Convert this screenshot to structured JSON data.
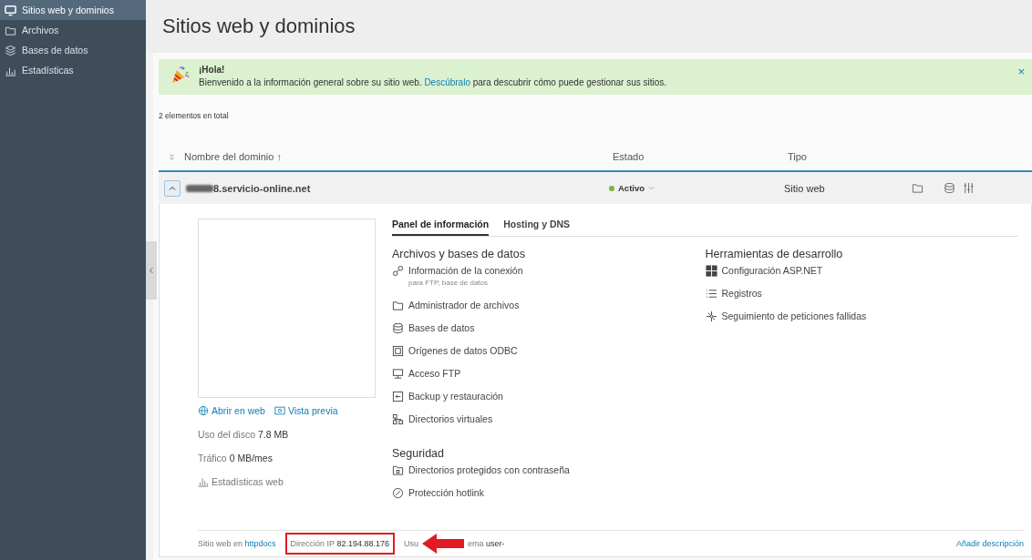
{
  "sidebar": {
    "items": [
      {
        "label": "Sitios web y dominios",
        "selected": true
      },
      {
        "label": "Archivos",
        "selected": false
      },
      {
        "label": "Bases de datos",
        "selected": false
      },
      {
        "label": "Estadísticas",
        "selected": false
      }
    ]
  },
  "page_title": "Sitios web y dominios",
  "banner": {
    "title": "¡Hola!",
    "text_before": "Bienvenido a la información general sobre su sitio web.",
    "link": "Descúbralo",
    "text_after": "para descubrir cómo puede gestionar sus sitios.",
    "close": "×"
  },
  "total": "2 elementos en total",
  "table": {
    "columns": [
      {
        "label": "Nombre del dominio",
        "sort": "↑"
      },
      {
        "label": "Estado"
      },
      {
        "label": "Tipo"
      }
    ],
    "rows": [
      {
        "domain": "8.servicio-online.net",
        "expanded": true,
        "status": "Activo",
        "color": "#7cb342",
        "type": "Sitio web"
      }
    ]
  },
  "details": {
    "links": [
      "Abrir en web",
      "Vista previa"
    ],
    "disk": "Uso del disco **7.8 MB**",
    "traffic": "Tráfico **0 MB/mes**",
    "stats_link": "Estadísticas web",
    "tabs": [
      {
        "label": "Panel de información",
        "selected": true
      },
      {
        "label": "Hosting y DNS",
        "selected": false
      }
    ],
    "sections": [
      {
        "title": "Archivos y bases de datos",
        "items": [
          {
            "label": "Información de la conexión",
            "note": "para FTP, base de datos"
          },
          {
            "label": "Administrador de archivos"
          },
          {
            "label": "Bases de datos"
          },
          {
            "label": "Orígenes de datos ODBC"
          },
          {
            "label": "Acceso FTP"
          },
          {
            "label": "Backup y restauración"
          },
          {
            "label": "Directorios virtuales"
          }
        ]
      },
      {
        "title": "Seguridad",
        "items": [
          {
            "label": "Directorios protegidos con contraseña"
          },
          {
            "label": "Protección hotlink"
          }
        ]
      },
      {
        "title": "Herramientas de desarrollo",
        "items": [
          {
            "label": "Configuración ASP.NET"
          },
          {
            "label": "Registros"
          },
          {
            "label": "Seguimiento de peticiones fallidas"
          }
        ]
      }
    ],
    "footer": {
      "root_prefix": "Sitio web en",
      "root_link": "httpdocs",
      "ip": "Dirección IP **82.194.88.176**",
      "user_start": "Usu",
      "user_end": "ema **user-**",
      "add_description": "Añadir descripción"
    }
  }
}
